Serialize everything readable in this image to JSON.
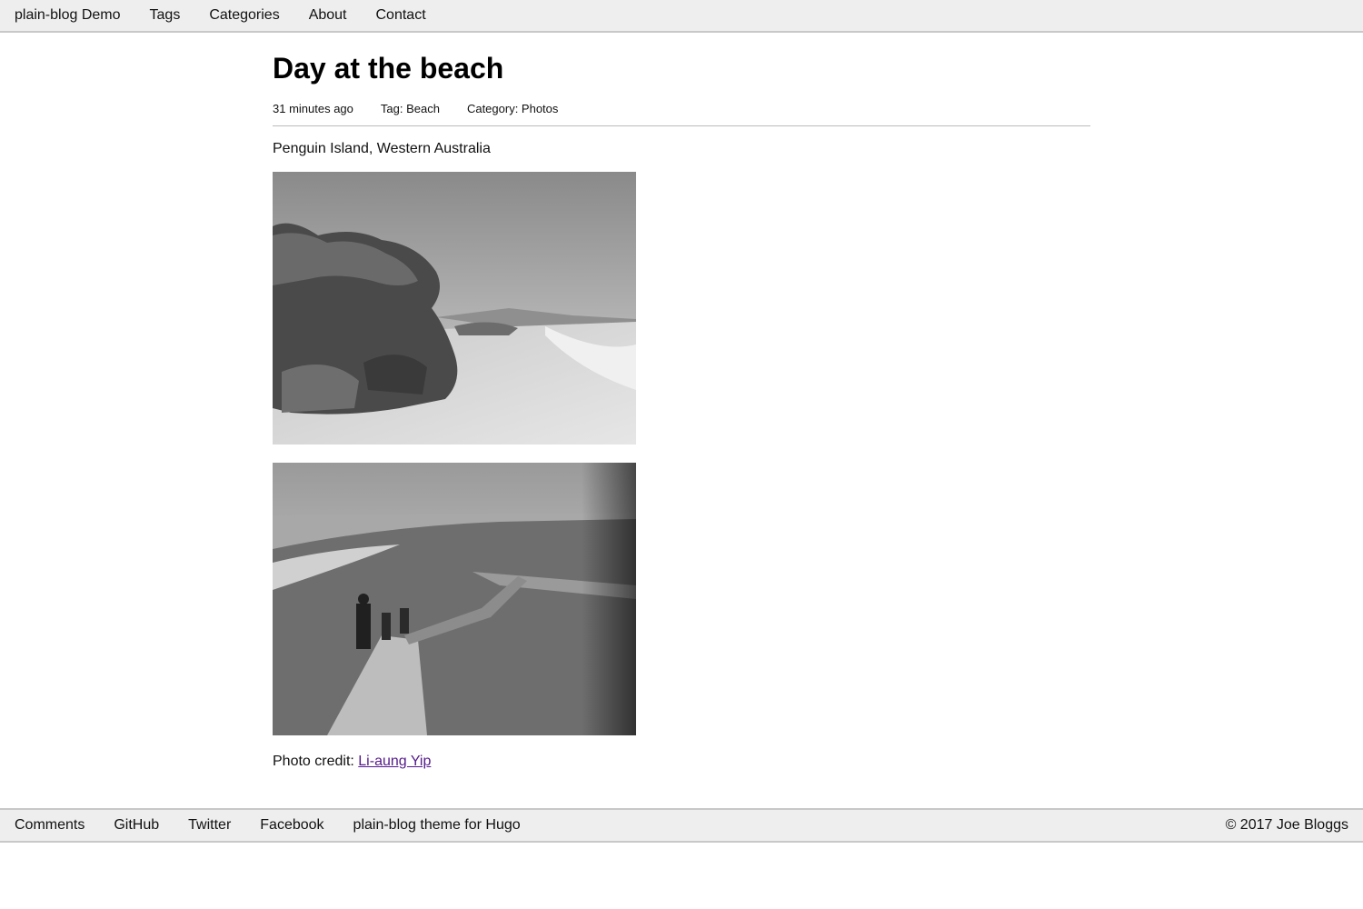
{
  "topnav": {
    "items": [
      {
        "label": "plain-blog Demo"
      },
      {
        "label": "Tags"
      },
      {
        "label": "Categories"
      },
      {
        "label": "About"
      },
      {
        "label": "Contact"
      }
    ]
  },
  "post": {
    "title": "Day at the beach",
    "time": "31 minutes ago",
    "tag": "Tag: Beach",
    "category": "Category: Photos",
    "subtitle": "Penguin Island, Western Australia",
    "credit_prefix": "Photo credit: ",
    "credit_link": "Li-aung Yip"
  },
  "footer": {
    "items": [
      {
        "label": "Comments"
      },
      {
        "label": "GitHub"
      },
      {
        "label": "Twitter"
      },
      {
        "label": "Facebook"
      },
      {
        "label": "plain-blog theme for Hugo"
      }
    ],
    "copyright": "© 2017 Joe Bloggs"
  }
}
